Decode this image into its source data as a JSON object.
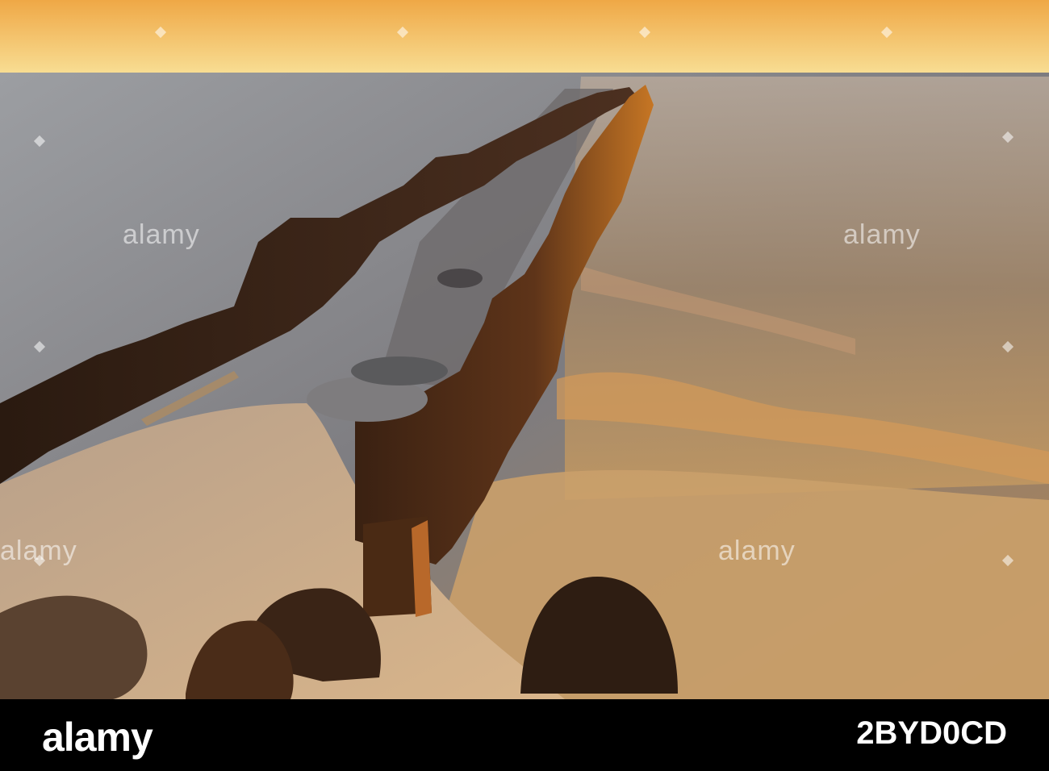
{
  "photo": {
    "subject": "wooden-groyne-at-sunset",
    "colors": {
      "sky_top": "#f2b34e",
      "sky_horizon": "#f7d98a",
      "sea": "#8a8a90",
      "sand": "#c9aa84",
      "wood": "#5a3318",
      "highlight": "#e08a2a"
    }
  },
  "watermark": {
    "text": "alamy"
  },
  "footer": {
    "logo": "alamy",
    "image_id": "2BYD0CD"
  }
}
